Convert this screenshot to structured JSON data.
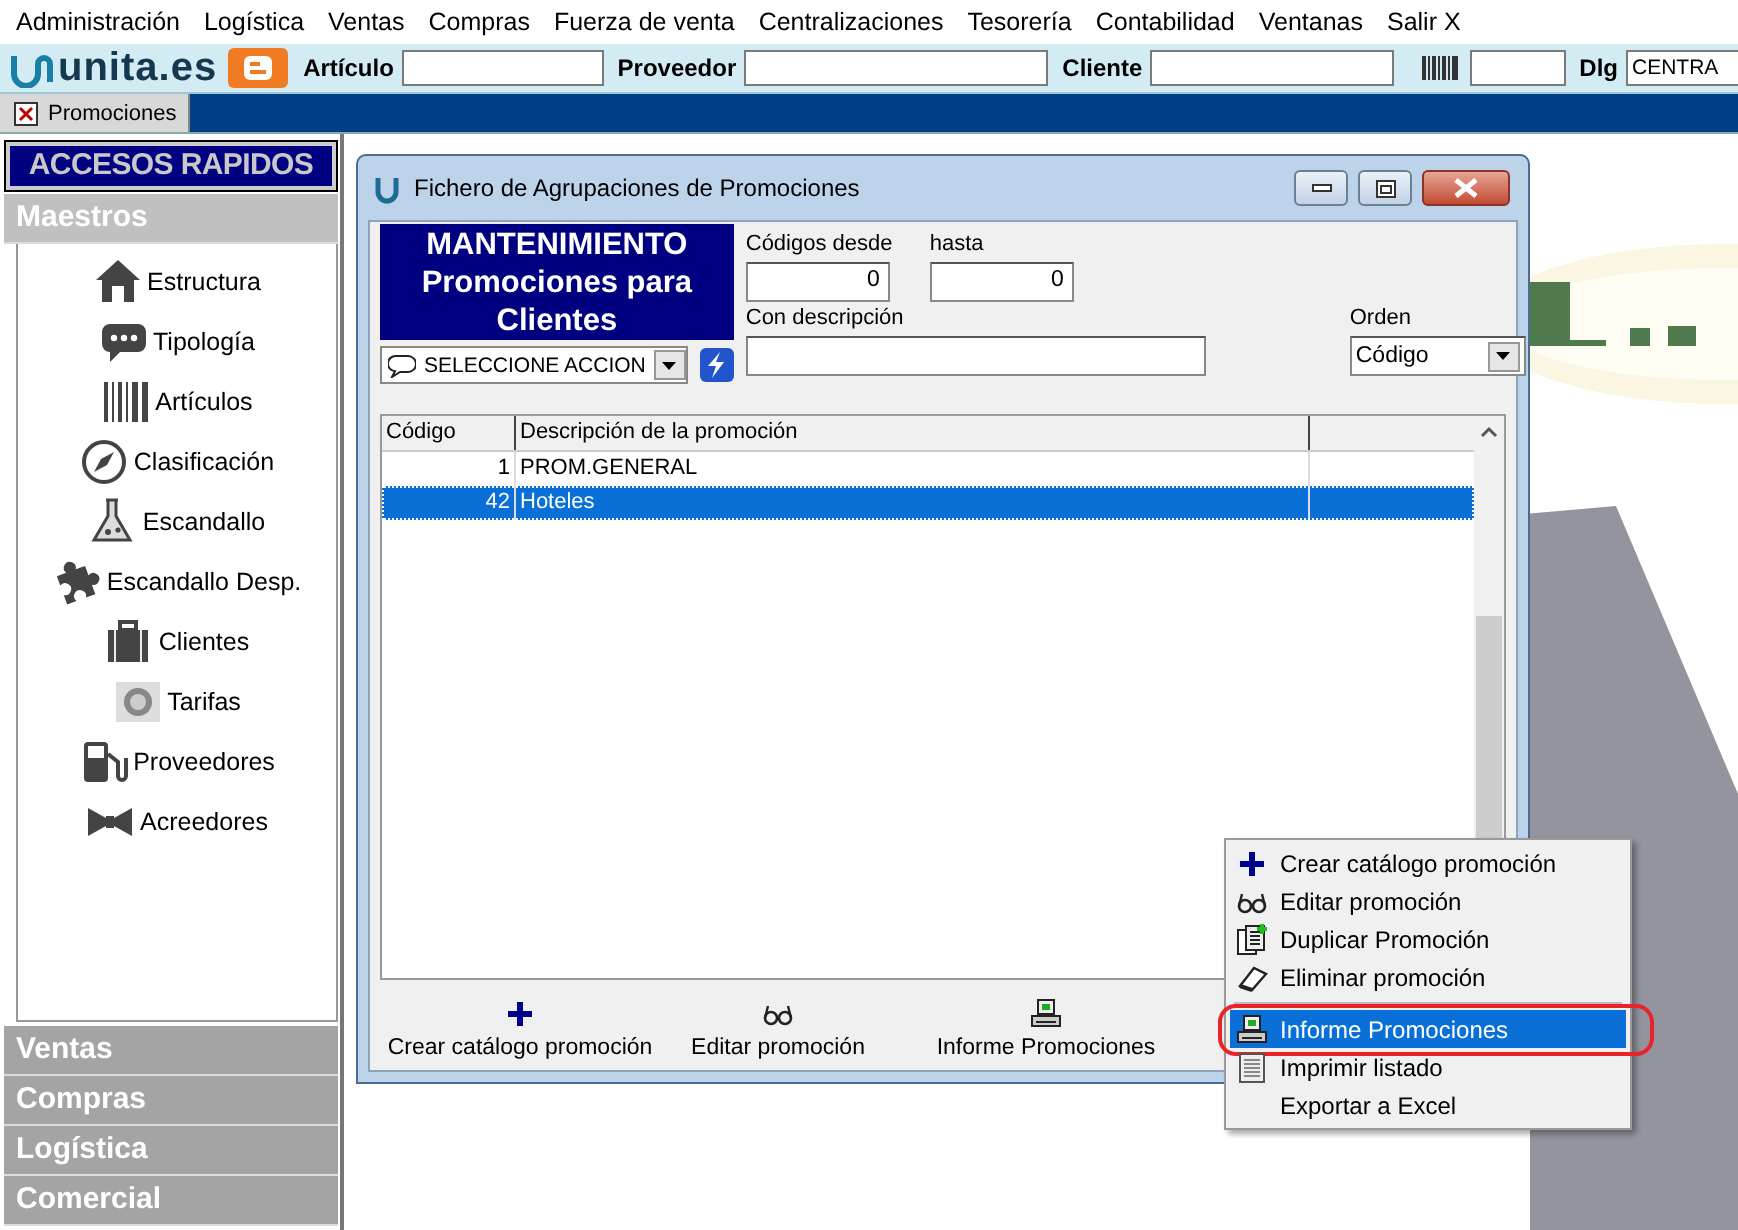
{
  "menu_bar": [
    "Administración",
    "Logística",
    "Ventas",
    "Compras",
    "Fuerza de venta",
    "Centralizaciones",
    "Tesorería",
    "Contabilidad",
    "Ventanas",
    "Salir X"
  ],
  "toolbar": {
    "logo": "unita.es",
    "fields": [
      {
        "kind": "text",
        "label": "Artículo"
      },
      {
        "kind": "text",
        "label": "Proveedor"
      },
      {
        "kind": "text",
        "label": "Cliente"
      },
      {
        "kind": "barcode"
      },
      {
        "kind": "text",
        "label": "Dlg",
        "value": "CENTRA"
      }
    ]
  },
  "tabs": [
    {
      "label": "Promociones",
      "selected": true
    }
  ],
  "sidebar": {
    "title": "ACCESOS RAPIDOS",
    "sections": [
      {
        "label": "Maestros",
        "expanded": true,
        "items": [
          "Estructura",
          "Tipología",
          "Artículos",
          "Clasificación",
          "Escandallo",
          "Escandallo Desp.",
          "Clientes",
          "Tarifas",
          "Proveedores",
          "Acreedores"
        ]
      },
      {
        "label": "Ventas",
        "expanded": false
      },
      {
        "label": "Compras",
        "expanded": false
      },
      {
        "label": "Logística",
        "expanded": false
      },
      {
        "label": "Comercial",
        "expanded": false
      }
    ]
  },
  "window": {
    "title": "Fichero de Agrupaciones de Promociones",
    "header": "MANTENIMIENTO Promociones para Clientes",
    "action_select": "SELECCIONE ACCION",
    "filters": {
      "from_label": "Códigos desde",
      "from_value": "0",
      "to_label": "hasta",
      "to_value": "0",
      "description_label": "Con descripción",
      "order_label": "Orden",
      "order_value": "Código"
    },
    "table": {
      "columns": [
        "Código",
        "Descripción de la promoción"
      ],
      "rows": [
        {
          "cells": [
            "1",
            "PROM.GENERAL"
          ],
          "selected": false
        },
        {
          "cells": [
            "42",
            "Hoteles"
          ],
          "selected": true
        }
      ]
    },
    "footer_buttons": [
      "Crear catálogo promoción",
      "Editar promoción",
      "Informe Promociones"
    ]
  },
  "context_menu": {
    "items": [
      {
        "label": "Crear catálogo promoción",
        "selected": false,
        "circled": false,
        "separator_above": false
      },
      {
        "label": "Editar promoción",
        "selected": false,
        "circled": false,
        "separator_above": false
      },
      {
        "label": "Duplicar Promoción",
        "selected": false,
        "circled": false,
        "separator_above": false
      },
      {
        "label": "Eliminar promoción",
        "selected": false,
        "circled": false,
        "separator_above": false
      },
      {
        "label": "Informe Promociones",
        "selected": true,
        "circled": true,
        "separator_above": true
      },
      {
        "label": "Imprimir listado",
        "selected": false,
        "circled": false,
        "separator_above": false
      },
      {
        "label": "Exportar a Excel",
        "selected": false,
        "circled": false,
        "separator_above": false
      }
    ]
  }
}
